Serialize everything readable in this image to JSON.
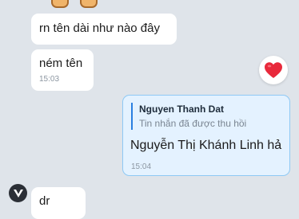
{
  "colors": {
    "background": "#dfe4ea",
    "received_bubble": "#ffffff",
    "sent_bubble": "#e4f2ff",
    "sent_border": "#8ec9f5",
    "quote_bar": "#2a7fe0",
    "heart": "#e8293b"
  },
  "messages": [
    {
      "text": "rn tên dài như nào đây"
    },
    {
      "text": "ném tên",
      "time": "15:03"
    }
  ],
  "reaction": {
    "icon": "heart-icon"
  },
  "sent_message": {
    "quote_author": "Nguyen Thanh Dat",
    "quote_text": "Tin nhắn đã được thu hồi",
    "text": "Nguyễn Thị Khánh Linh hả",
    "time": "15:04"
  },
  "last_message": {
    "avatar_icon": "avatar-icon",
    "text": "dr"
  }
}
